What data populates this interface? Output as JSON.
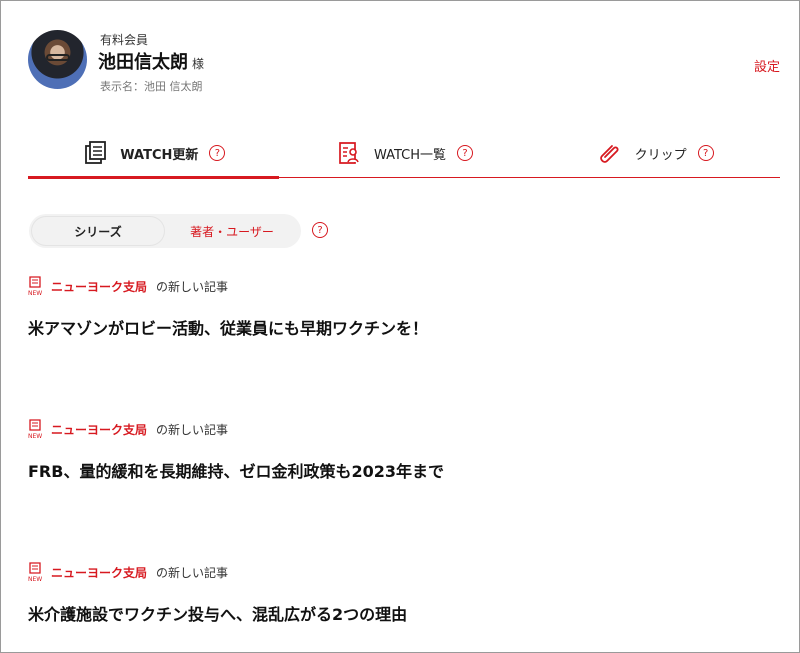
{
  "profile": {
    "member_type": "有料会員",
    "name": "池田信太朗",
    "honorific": "様",
    "display_name": "表示名：池田 信太朗",
    "settings": "設定"
  },
  "tabs": [
    {
      "label": "WATCH更新",
      "icon": "document-stack-icon",
      "active": true
    },
    {
      "label": "WATCH一覧",
      "icon": "person-list-icon",
      "active": false
    },
    {
      "label": "クリップ",
      "icon": "paperclip-icon",
      "active": false
    }
  ],
  "segment": {
    "series": "シリーズ",
    "authors": "著者・ユーザー",
    "help": "?"
  },
  "articles": [
    {
      "source": "ニューヨーク支局",
      "suffix": "の新しい記事",
      "title": "米アマゾンがロビー活動、従業員にも早期ワクチンを！"
    },
    {
      "source": "ニューヨーク支局",
      "suffix": "の新しい記事",
      "title": "FRB、量的緩和を長期維持、ゼロ金利政策も2023年まで"
    },
    {
      "source": "ニューヨーク支局",
      "suffix": "の新しい記事",
      "title": "米介護施設でワクチン投与へ、混乱広がる2つの理由"
    }
  ],
  "colors": {
    "accent": "#d71920",
    "text": "#222222",
    "segment_background": "#f2f2f2"
  }
}
